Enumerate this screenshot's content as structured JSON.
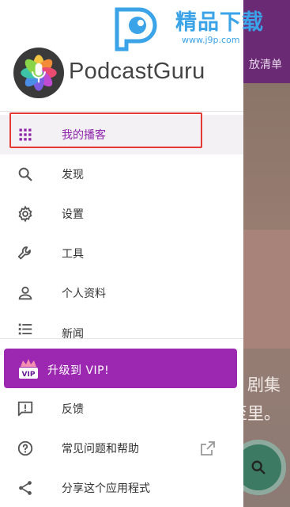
{
  "watermark": {
    "title": "精品下载",
    "url": "www.j9p.com"
  },
  "background": {
    "appbar_tab": "放清单",
    "body_lines": [
      "剧集",
      "至里。"
    ]
  },
  "drawer": {
    "app_name": "PodcastGuru",
    "items": [
      {
        "label": "我的播客",
        "icon": "grid-icon",
        "active": true
      },
      {
        "label": "发现",
        "icon": "search-icon"
      },
      {
        "label": "设置",
        "icon": "gear-icon"
      },
      {
        "label": "工具",
        "icon": "wrench-icon"
      },
      {
        "label": "个人资料",
        "icon": "person-icon"
      },
      {
        "label": "新闻",
        "icon": "list-icon"
      }
    ],
    "vip": {
      "label": "升级到 VIP!",
      "badge": "VIP"
    },
    "secondary_items": [
      {
        "label": "反馈",
        "icon": "feedback-icon"
      },
      {
        "label": "常见问题和帮助",
        "icon": "help-icon"
      },
      {
        "label": "分享这个应用程式",
        "icon": "share-icon"
      }
    ]
  },
  "colors": {
    "accent": "#9c27b0",
    "highlight": "#e53935",
    "watermark": "#3ba3e8"
  }
}
